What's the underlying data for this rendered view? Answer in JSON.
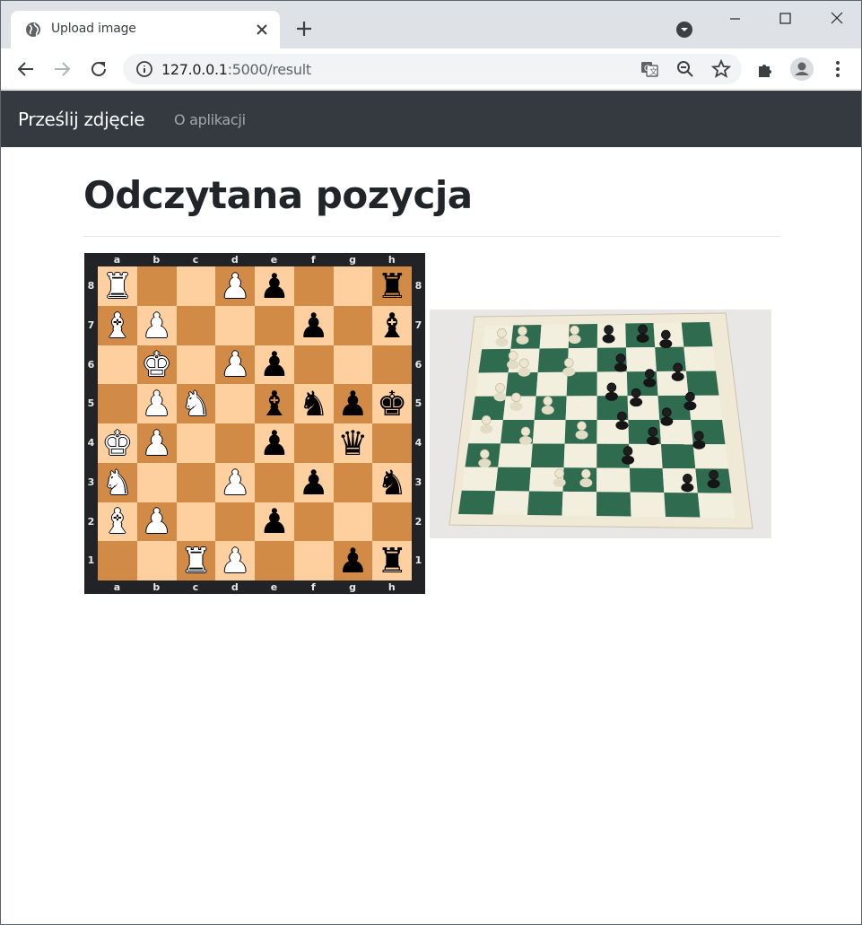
{
  "browser": {
    "tab_title": "Upload image",
    "url_host": "127.0.0.1",
    "url_rest": ":5000/result"
  },
  "navbar": {
    "brand": "Prześlij zdjęcie",
    "link_about": "O aplikacji"
  },
  "page": {
    "title": "Odczytana pozycja"
  },
  "board": {
    "files": [
      "a",
      "b",
      "c",
      "d",
      "e",
      "f",
      "g",
      "h"
    ],
    "ranks": [
      "8",
      "7",
      "6",
      "5",
      "4",
      "3",
      "2",
      "1"
    ],
    "position": [
      [
        "wR",
        "",
        "",
        "wP",
        "bP",
        "",
        "",
        "bR"
      ],
      [
        "wB",
        "wP",
        "",
        "",
        "",
        "bP",
        "",
        "bB"
      ],
      [
        "",
        "wK",
        "",
        "wP",
        "bP",
        "",
        "",
        ""
      ],
      [
        "",
        "wP",
        "wN",
        "",
        "bB",
        "bN",
        "bP",
        "bK"
      ],
      [
        "wK",
        "wP",
        "",
        "",
        "bP",
        "",
        "bQ",
        ""
      ],
      [
        "wN",
        "",
        "",
        "wP",
        "",
        "bP",
        "",
        "bN"
      ],
      [
        "wB",
        "wP",
        "",
        "",
        "bP",
        "",
        "",
        ""
      ],
      [
        "",
        "",
        "wR",
        "wP",
        "",
        "",
        "bP",
        "bR"
      ]
    ]
  },
  "photo": {
    "alt": "chessboard-photo"
  },
  "colors": {
    "navbar_bg": "#343a40",
    "light_square": "#fecf9f",
    "dark_square": "#d18b47",
    "board_frame": "#222326"
  }
}
